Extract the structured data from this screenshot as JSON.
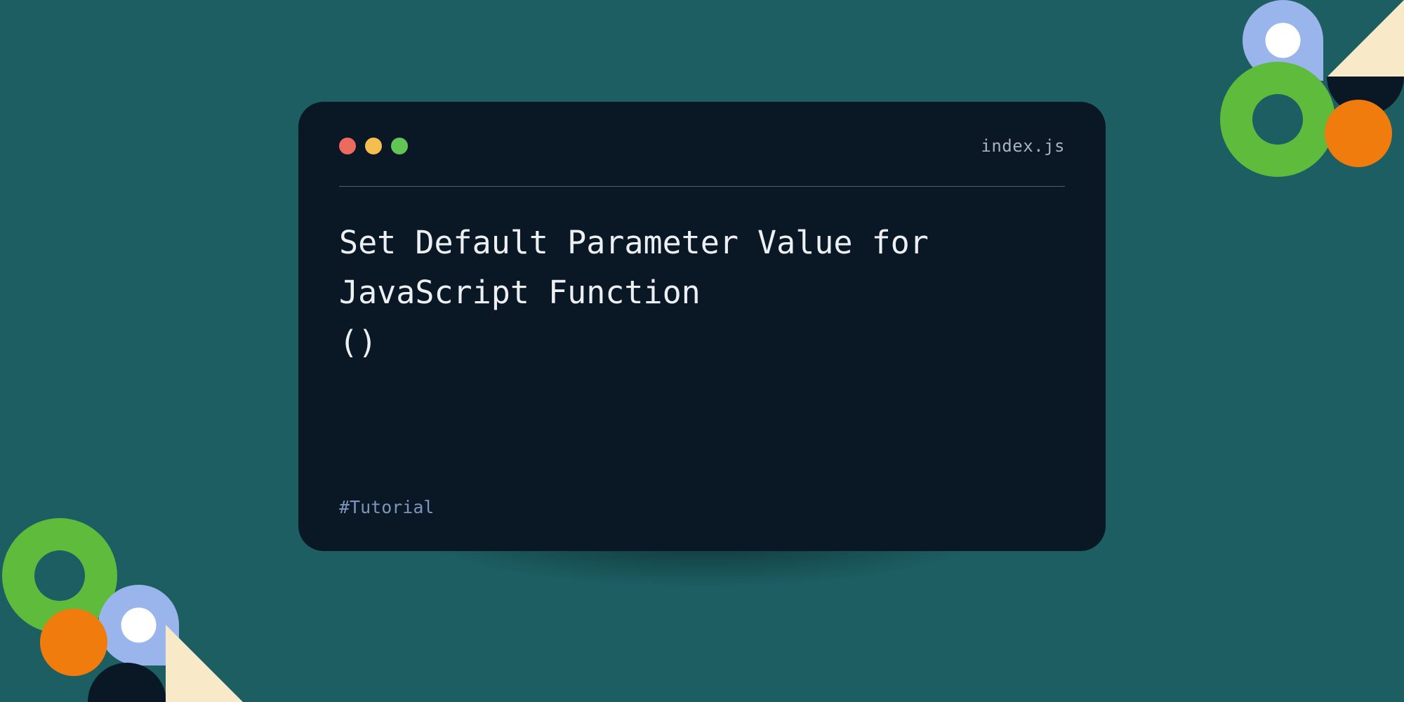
{
  "window": {
    "filename": "index.js",
    "title": "Set Default Parameter Value for\nJavaScript Function\n()",
    "tag": "#Tutorial"
  },
  "colors": {
    "background": "#1c5e62",
    "panel": "#0a1826",
    "text": "#ecf0f3",
    "muted": "#a8b2be",
    "tag": "#7e94ba",
    "traffic_red": "#ec6a5e",
    "traffic_yellow": "#f4bf4f",
    "traffic_green": "#61c454",
    "accent_green": "#5fbb3b",
    "accent_orange": "#f07c0e",
    "accent_blue": "#9ab4ec",
    "accent_cream": "#f8e9c8",
    "accent_dark": "#0a1826",
    "accent_white": "#ffffff"
  }
}
